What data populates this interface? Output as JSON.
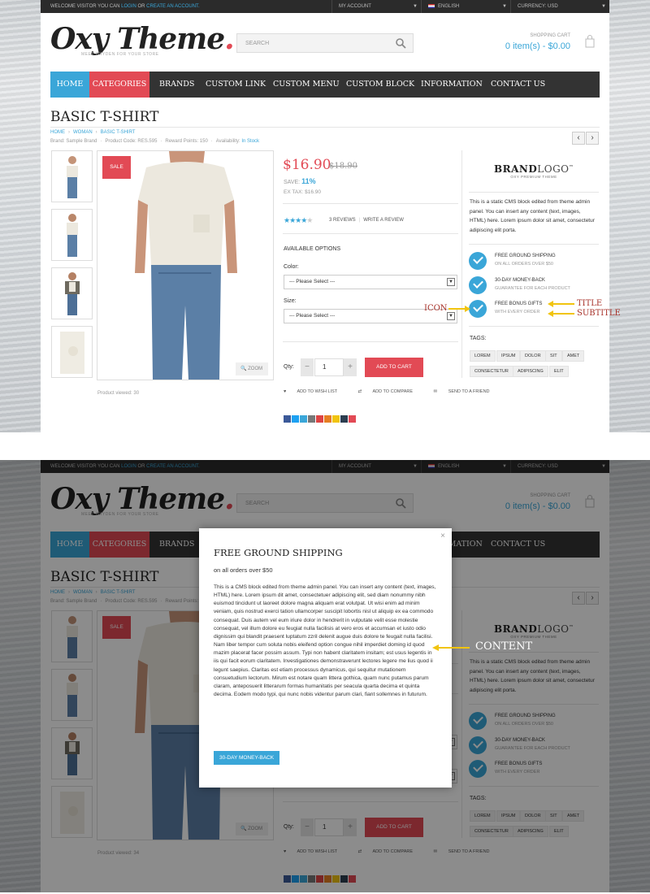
{
  "topbar": {
    "welcome_pre": "WELCOME VISITOR YOU CAN",
    "login": "LOGIN",
    "or": "OR",
    "create": "CREATE AN ACCOUNT.",
    "account": "MY ACCOUNT",
    "language": "ENGLISH",
    "currency": "CURRENCY: USD"
  },
  "logo": {
    "text": "Oxy Theme",
    "tagline": "MEET OXYDEN FOR YOUR STORE"
  },
  "search": {
    "placeholder": "SEARCH"
  },
  "cart": {
    "label": "SHOPPING CART",
    "summary": "0 item(s) - $0.00"
  },
  "nav": [
    "HOME",
    "CATEGORIES",
    "BRANDS",
    "CUSTOM LINK",
    "CUSTOM MENU",
    "CUSTOM BLOCK",
    "INFORMATION",
    "CONTACT US"
  ],
  "colors": {
    "accent": "#3aa6d8",
    "red": "#e24a55",
    "dark_nav": "#333333",
    "annotation_arrow": "#f1c40f",
    "annotation_text": "#a8332b"
  },
  "product": {
    "title": "BASIC T-SHIRT",
    "breadcrumb": [
      "HOME",
      "WOMAN",
      "BASIC T-SHIRT"
    ],
    "brand": "Brand: Sample Brand",
    "code": "Product Code: RES.595",
    "points": "Reward Points: 150",
    "availability": "Availability:",
    "in_stock": "In Stock",
    "sale": "SALE",
    "zoom": "ZOOM",
    "price": "$16.90",
    "old_price": "$18.90",
    "save_label": "SAVE:",
    "save_value": "11%",
    "extax": "EX TAX: $16.90",
    "rating": 4,
    "reviews": "3 REVIEWS",
    "write_review": "WRITE A REVIEW",
    "options_title": "AVAILABLE OPTIONS",
    "color_label": "Color:",
    "size_label": "Size:",
    "select_placeholder": "--- Please Select ---",
    "qty_label": "Qty:",
    "qty": "1",
    "minus": "−",
    "plus": "+",
    "add_to_cart": "ADD TO CART",
    "wishlist": "ADD TO WISH LIST",
    "compare": "ADD TO COMPARE",
    "friend": "SEND TO A FRIEND",
    "viewed_1": "Product viewed: 30",
    "viewed_2": "Product viewed: 34"
  },
  "sidebar": {
    "brand_main": "BRAND",
    "brand_logo": "LOGO",
    "brand_tm": "™",
    "brand_sub": "OXY PREMIUM THEME",
    "static_text": "This is a static CMS block edited from theme admin panel. You can insert any content (text, images, HTML) here. Lorem ipsum dolor sit amet, consectetur adipiscing elit porta.",
    "features": [
      {
        "title": "FREE GROUND SHIPPING",
        "subtitle": "ON ALL ORDERS OVER $50"
      },
      {
        "title": "30-DAY MONEY-BACK",
        "subtitle": "GUARANTEE FOR EACH PRODUCT"
      },
      {
        "title": "FREE BONUS GIFTS",
        "subtitle": "WITH EVERY ORDER"
      }
    ],
    "tags_title": "TAGS:",
    "tags": [
      "LOREM",
      "IPSUM",
      "DOLOR",
      "SIT",
      "AMET",
      "CONSECTETUR",
      "ADIPISCING",
      "ELIT"
    ]
  },
  "annotations": {
    "icon": "ICON",
    "title": "TITLE",
    "subtitle": "SUBTITLE",
    "content": "CONTENT"
  },
  "modal": {
    "close": "×",
    "title": "FREE GROUND SHIPPING",
    "subtitle": "on all orders over $50",
    "content": "This is a CMS block edited from theme admin panel. You can insert any content (text, images, HTML) here. Lorem ipsum dit amet, consectetuer adipiscing elit, sed diam nonummy nibh euismod tincidunt ut laoreet dolore magna aliquam erat volutpat. Ut wisi enim ad minim veniam, quis nostrud exerci tation ullamcorper suscipit lobortis nisl ut aliquip ex ea commodo consequat. Duis autem vel eum iriure dolor in hendrerit in vulputate velit esse molestie consequat, vel illum dolore eu feugiat nulla facilisis at vero eros et accumsan et iusto odio dignissim qui blandit praesent luptatum zzril delenit augue duis dolore te feugait nulla facilisi. Nam liber tempor cum soluta nobis eleifend option congue nihil imperdiet doming id quod mazim placerat facer possim assum. Typi non habent claritatem insitam; est usus legentis in iis qui facit eorum claritatem. Investigationes demonstraverunt lectores legere me lius quod ii legunt saepius. Claritas est etiam processus dynamicus, qui sequitur mutationem consuetudium lectorum. Mirum est notare quam littera gothica, quam nunc putamus parum claram, anteposuerit litterarum formas humanitatis per seacula quarta decima et quinta decima. Eodem modo typi, qui nunc nobis videntur parum clari, fiant sollemnes in futurum.",
    "button": "30-DAY MONEY-BACK"
  }
}
